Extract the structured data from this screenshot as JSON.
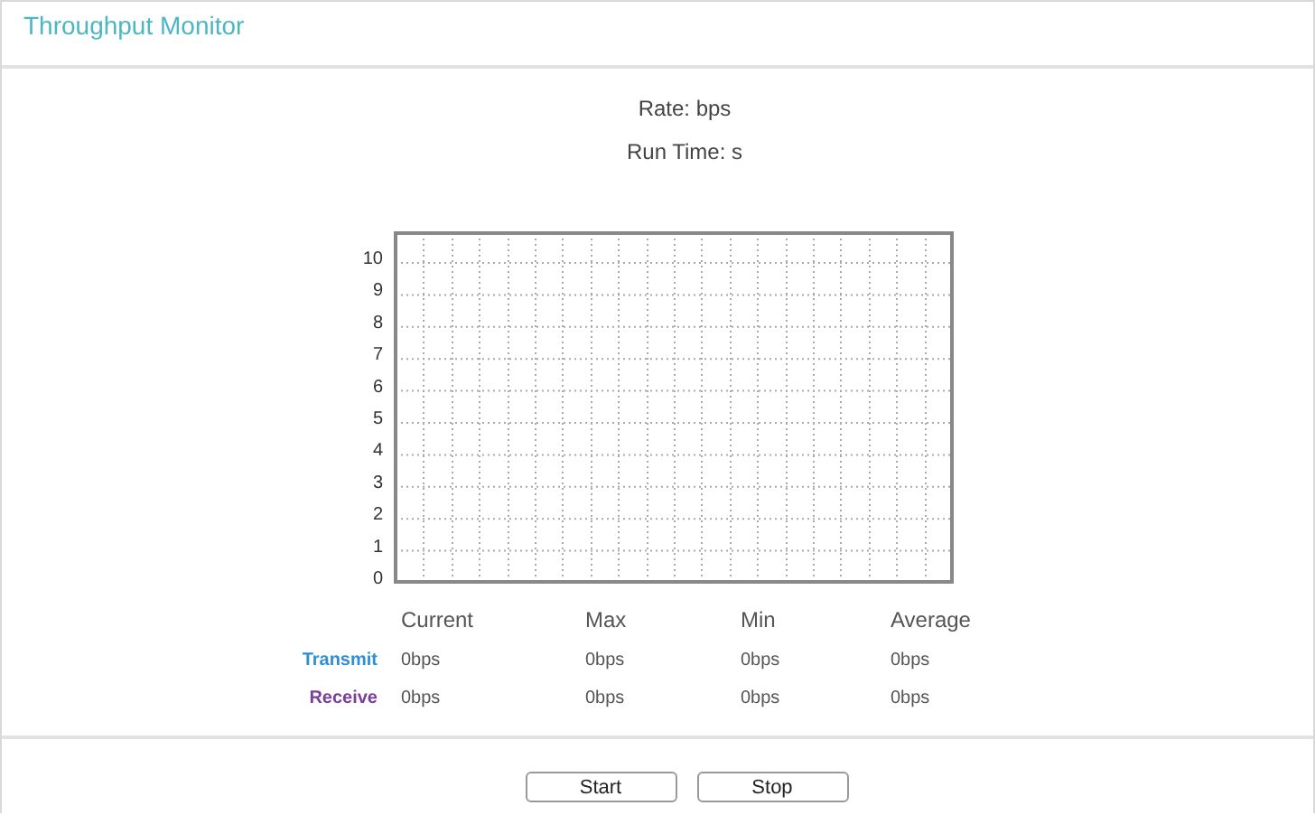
{
  "header": {
    "title": "Throughput Monitor"
  },
  "summary": [
    {
      "label": "Rate:",
      "value": "bps"
    },
    {
      "label": "Run Time:",
      "value": "s"
    }
  ],
  "chart": {
    "y_labels": [
      "10",
      "9",
      "8",
      "7",
      "6",
      "5",
      "4",
      "3",
      "2",
      "1",
      "0"
    ]
  },
  "stats": {
    "columns": [
      "Current",
      "Max",
      "Min",
      "Average"
    ],
    "rows": [
      {
        "label": "Transmit",
        "color": "#2e8fd6",
        "values": [
          "0bps",
          "0bps",
          "0bps",
          "0bps"
        ]
      },
      {
        "label": "Receive",
        "color": "#7b3f98",
        "values": [
          "0bps",
          "0bps",
          "0bps",
          "0bps"
        ]
      }
    ]
  },
  "buttons": [
    "Start",
    "Stop"
  ]
}
